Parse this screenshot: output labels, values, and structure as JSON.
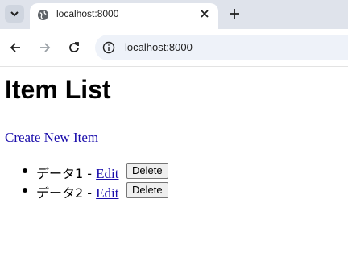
{
  "browser": {
    "tab_title": "localhost:8000",
    "url": "localhost:8000"
  },
  "page": {
    "heading": "Item List",
    "create_link": "Create New Item",
    "items": [
      {
        "name": "データ1",
        "separator": " - ",
        "edit_label": "Edit",
        "delete_label": "Delete"
      },
      {
        "name": "データ2",
        "separator": " - ",
        "edit_label": "Edit",
        "delete_label": "Delete"
      }
    ]
  },
  "icons": {
    "tab_search": "chevron-down-icon",
    "favicon": "globe-icon",
    "close": "close-icon",
    "new_tab": "plus-icon",
    "back": "back-arrow-icon",
    "forward": "forward-arrow-icon",
    "reload": "reload-icon",
    "site_info": "info-icon"
  }
}
